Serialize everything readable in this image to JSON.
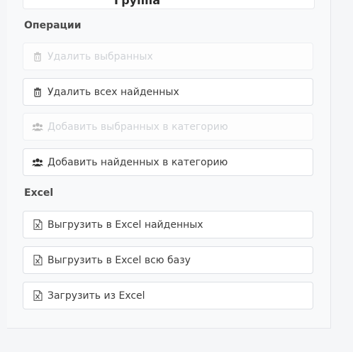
{
  "top_fragment": "Группа",
  "sections": {
    "operations_title": "Операции",
    "excel_title": "Excel"
  },
  "operations": {
    "delete_selected": "Удалить выбранных",
    "delete_found": "Удалить всех найденных",
    "add_selected_category": "Добавить выбранных в категорию",
    "add_found_category": "Добавить найденных в категорию"
  },
  "excel": {
    "export_found": "Выгрузить в Excel найденных",
    "export_all": "Выгрузить в Excel всю базу",
    "import": "Загрузить из Excel"
  },
  "icons": {
    "delete": "trash-icon",
    "category": "users-icon",
    "excel": "excel-file-icon"
  },
  "colors": {
    "text": "#3d3d3d",
    "disabled_text": "#cfd2d6",
    "border": "#dcdfe4",
    "panel_bg": "#f8f9fa"
  }
}
